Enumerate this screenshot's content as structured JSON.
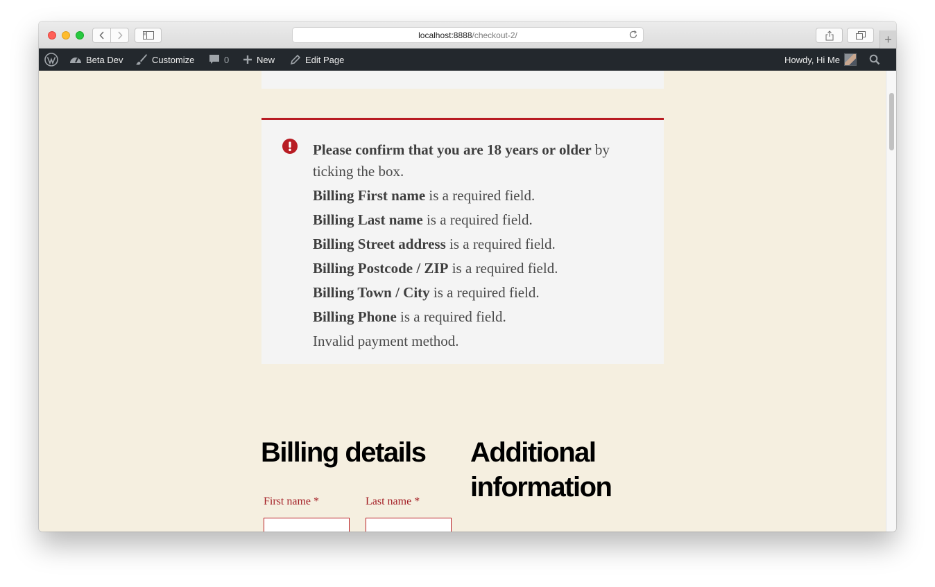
{
  "browser": {
    "url_host": "localhost:8888",
    "url_path": "/checkout-2/"
  },
  "adminbar": {
    "site_name": "Beta Dev",
    "customize": "Customize",
    "comments_count": "0",
    "new_label": "New",
    "edit_page": "Edit Page",
    "howdy": "Howdy, Hi Me"
  },
  "notice": {
    "errors": [
      {
        "bold": "Please confirm that you are 18 years or older",
        "rest": " by ticking the box."
      },
      {
        "bold": "Billing First name",
        "rest": " is a required field."
      },
      {
        "bold": "Billing Last name",
        "rest": " is a required field."
      },
      {
        "bold": "Billing Street address",
        "rest": " is a required field."
      },
      {
        "bold": "Billing Postcode / ZIP",
        "rest": " is a required field."
      },
      {
        "bold": "Billing Town / City",
        "rest": " is a required field."
      },
      {
        "bold": "Billing Phone",
        "rest": " is a required field."
      },
      {
        "bold": "",
        "rest": "Invalid payment method."
      }
    ],
    "accent": "#b81c23"
  },
  "billing": {
    "heading": "Billing details",
    "first_name_label": "First name",
    "last_name_label": "Last name",
    "required_mark": "*"
  },
  "additional": {
    "heading": "Additional information"
  }
}
